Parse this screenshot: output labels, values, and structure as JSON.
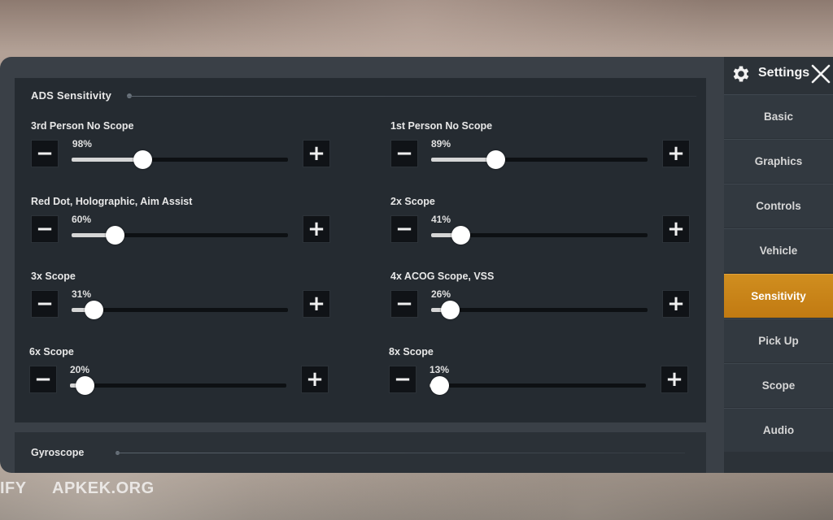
{
  "sections": {
    "ads": {
      "title": "ADS Sensitivity"
    },
    "gyro": {
      "title": "Gyroscope"
    }
  },
  "settings": [
    {
      "label": "3rd Person No Scope",
      "value": 98,
      "value_text": "98%"
    },
    {
      "label": "1st Person No Scope",
      "value": 89,
      "value_text": "89%"
    },
    {
      "label": "Red Dot, Holographic, Aim Assist",
      "value": 60,
      "value_text": "60%"
    },
    {
      "label": "2x Scope",
      "value": 41,
      "value_text": "41%"
    },
    {
      "label": "3x Scope",
      "value": 31,
      "value_text": "31%"
    },
    {
      "label": "4x ACOG Scope, VSS",
      "value": 26,
      "value_text": "26%"
    },
    {
      "label": "6x Scope",
      "value": 20,
      "value_text": "20%"
    },
    {
      "label": "8x Scope",
      "value": 13,
      "value_text": "13%"
    }
  ],
  "slider_max": 300,
  "controls": {
    "minus_glyph": "−",
    "plus_glyph": "+"
  },
  "sidebar": {
    "title": "Settings",
    "items": [
      {
        "label": "Basic"
      },
      {
        "label": "Graphics"
      },
      {
        "label": "Controls"
      },
      {
        "label": "Vehicle"
      },
      {
        "label": "Sensitivity",
        "active": true
      },
      {
        "label": "Pick Up"
      },
      {
        "label": "Scope"
      },
      {
        "label": "Audio"
      }
    ]
  },
  "watermarks": {
    "left": "IFY",
    "right": "APKEK.ORG"
  },
  "colors": {
    "accent": "#c98418",
    "panel": "#252b31",
    "sidebar": "#2c3238"
  },
  "icons": {
    "settings": "gear-icon",
    "close": "close-icon"
  }
}
